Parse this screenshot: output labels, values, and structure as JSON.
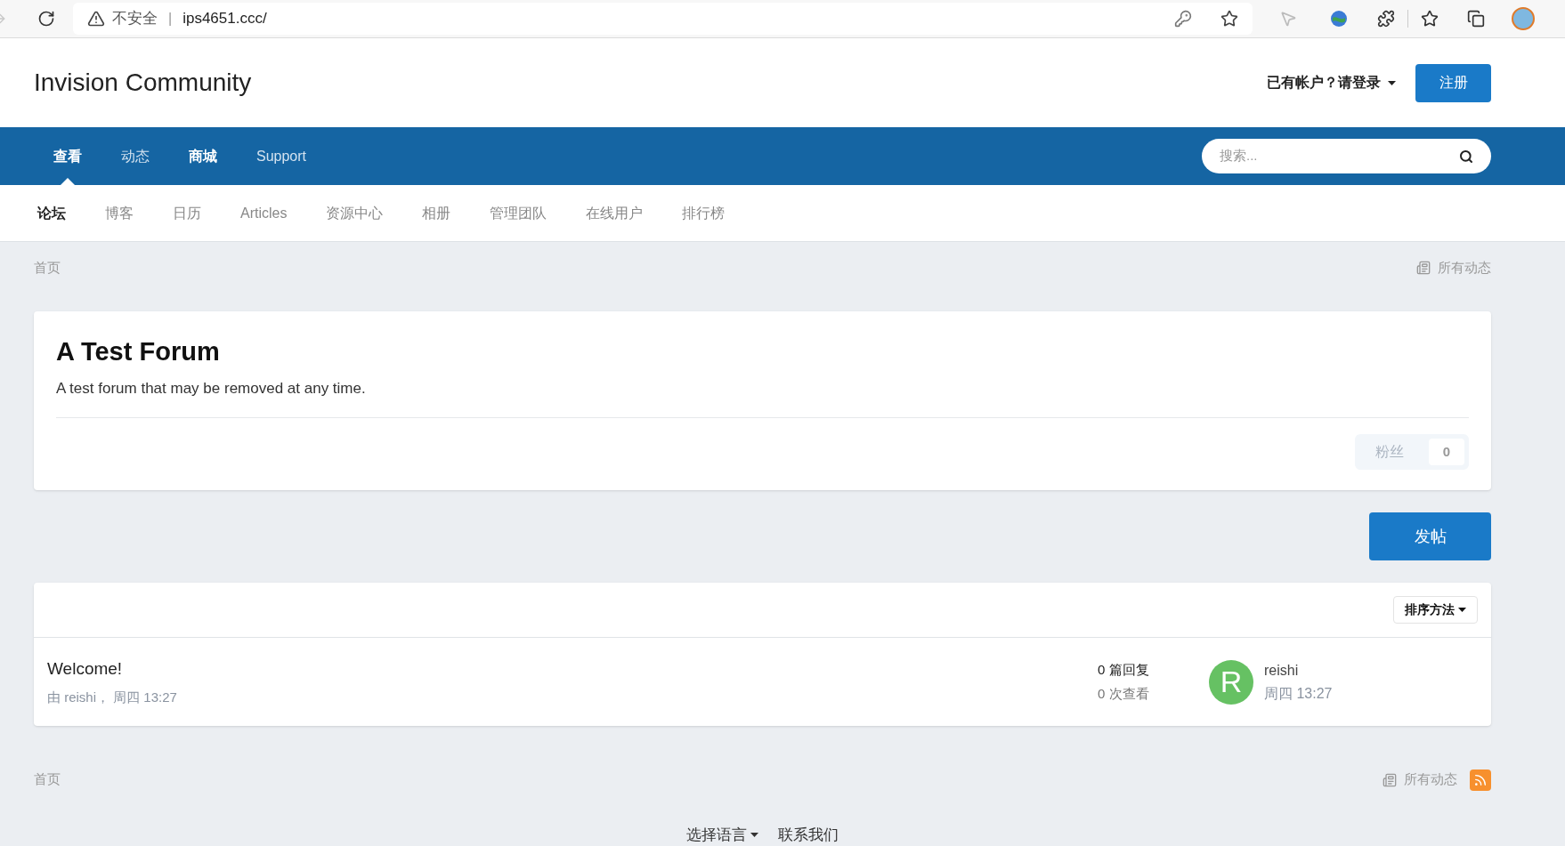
{
  "browser": {
    "security": "不安全",
    "separator": "|",
    "url": "ips4651.ccc/"
  },
  "header": {
    "site_title": "Invision Community",
    "login": "已有帐户？请登录",
    "register": "注册"
  },
  "nav": {
    "items": [
      {
        "label": "查看",
        "selected": true,
        "emphasized": true
      },
      {
        "label": "动态",
        "selected": false,
        "emphasized": false
      },
      {
        "label": "商城",
        "selected": false,
        "emphasized": true
      },
      {
        "label": "Support",
        "selected": false,
        "emphasized": false
      }
    ],
    "search": {
      "placeholder": "搜索..."
    }
  },
  "subnav": [
    {
      "label": "论坛",
      "selected": true
    },
    {
      "label": "博客",
      "selected": false
    },
    {
      "label": "日历",
      "selected": false
    },
    {
      "label": "Articles",
      "selected": false
    },
    {
      "label": "资源中心",
      "selected": false
    },
    {
      "label": "相册",
      "selected": false
    },
    {
      "label": "管理团队",
      "selected": false
    },
    {
      "label": "在线用户",
      "selected": false
    },
    {
      "label": "排行榜",
      "selected": false
    }
  ],
  "breadcrumb_top": {
    "home": "首页",
    "all_activity": "所有动态"
  },
  "forum": {
    "title": "A Test Forum",
    "description": "A test forum that may be removed at any time.",
    "followers_label": "粉丝",
    "followers_count": "0"
  },
  "new_topic_button": "发帖",
  "topic_list": {
    "sort_button": "排序方法",
    "topics": [
      {
        "title": "Welcome!",
        "meta": "由 reishi， 周四 13:27",
        "replies_count": "0",
        "replies_label": "篇回复",
        "views_count": "0",
        "views_label": "次查看",
        "avatar_letter": "R",
        "color": "#66c163",
        "last_user": "reishi",
        "last_time": "周四 13:27"
      }
    ]
  },
  "breadcrumb_bottom": {
    "home": "首页",
    "all_activity": "所有动态"
  },
  "footer": {
    "language": "选择语言",
    "contact": "联系我们"
  }
}
